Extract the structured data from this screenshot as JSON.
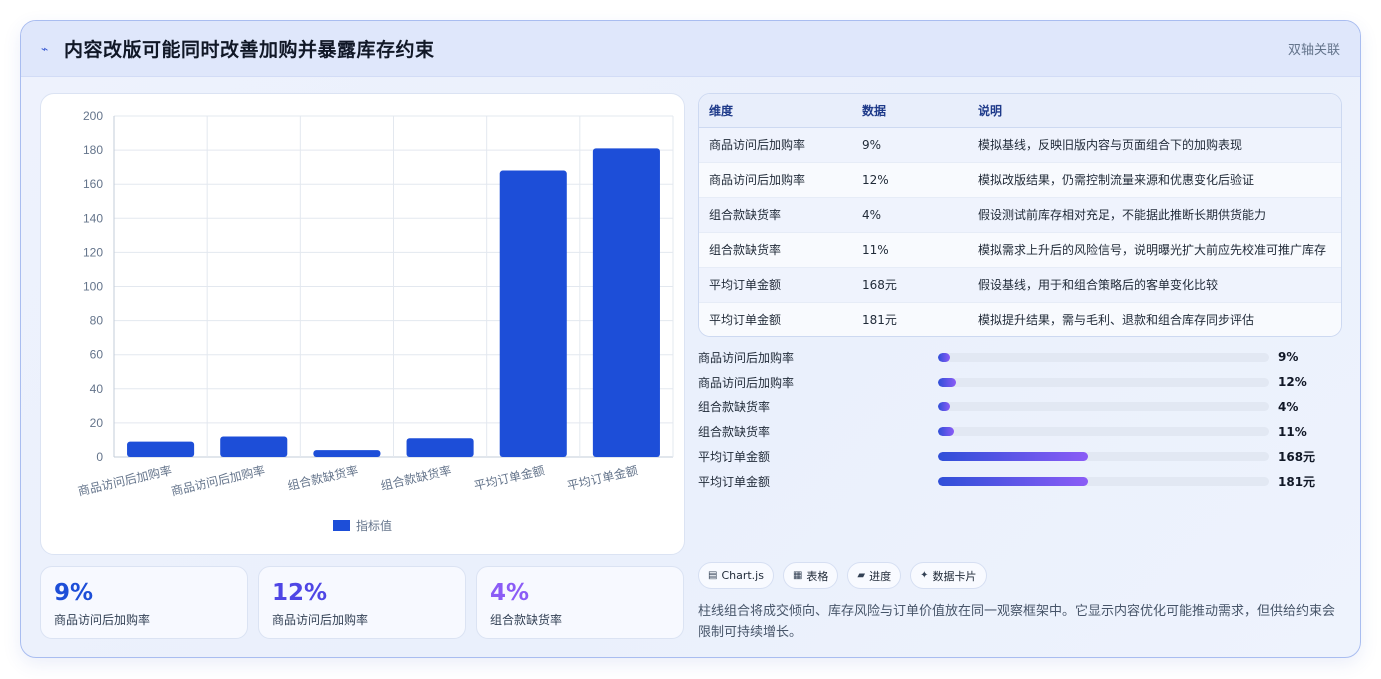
{
  "header": {
    "title": "内容改版可能同时改善加购并暴露库存约束",
    "tag": "双轴关联",
    "icon": "chart-line-icon"
  },
  "chart_data": {
    "type": "bar",
    "categories": [
      "商品访问后加购率",
      "商品访问后加购率",
      "组合款缺货率",
      "组合款缺货率",
      "平均订单金额",
      "平均订单金额"
    ],
    "series": [
      {
        "name": "指标值",
        "values": [
          9,
          12,
          4,
          11,
          168,
          181
        ],
        "color": "#1d4ed8"
      }
    ],
    "ylim": [
      0,
      200
    ],
    "yticks": [
      0,
      20,
      40,
      60,
      80,
      100,
      120,
      140,
      160,
      180,
      200
    ],
    "grid": true,
    "legend_position": "bottom"
  },
  "stats": [
    {
      "value": "9%",
      "label": "商品访问后加购率",
      "color": "#1d4ed8"
    },
    {
      "value": "12%",
      "label": "商品访问后加购率",
      "color": "#4f46e5"
    },
    {
      "value": "4%",
      "label": "组合款缺货率",
      "color": "#8b5cf6"
    }
  ],
  "table": {
    "headers": [
      "维度",
      "数据",
      "说明"
    ],
    "rows": [
      [
        "商品访问后加购率",
        "9%",
        "模拟基线，反映旧版内容与页面组合下的加购表现"
      ],
      [
        "商品访问后加购率",
        "12%",
        "模拟改版结果，仍需控制流量来源和优惠变化后验证"
      ],
      [
        "组合款缺货率",
        "4%",
        "假设测试前库存相对充足，不能据此推断长期供货能力"
      ],
      [
        "组合款缺货率",
        "11%",
        "模拟需求上升后的风险信号，说明曝光扩大前应先校准可推广库存"
      ],
      [
        "平均订单金额",
        "168元",
        "假设基线，用于和组合策略后的客单变化比较"
      ],
      [
        "平均订单金额",
        "181元",
        "模拟提升结果，需与毛利、退款和组合库存同步评估"
      ]
    ]
  },
  "progress": [
    {
      "label": "商品访问后加购率",
      "value": "9%",
      "fraction": 0.037
    },
    {
      "label": "商品访问后加购率",
      "value": "12%",
      "fraction": 0.054
    },
    {
      "label": "组合款缺货率",
      "value": "4%",
      "fraction": 0.037
    },
    {
      "label": "组合款缺货率",
      "value": "11%",
      "fraction": 0.049
    },
    {
      "label": "平均订单金额",
      "value": "168元",
      "fraction": 0.453
    },
    {
      "label": "平均订单金额",
      "value": "181元",
      "fraction": 0.453
    }
  ],
  "chips": [
    {
      "icon": "▤",
      "label": "Chart.js"
    },
    {
      "icon": "▦",
      "label": "表格"
    },
    {
      "icon": "▰",
      "label": "进度"
    },
    {
      "icon": "✦",
      "label": "数据卡片"
    }
  ],
  "description": "柱线组合将成交倾向、库存风险与订单价值放在同一观察框架中。它显示内容优化可能推动需求，但供给约束会限制可持续增长。"
}
